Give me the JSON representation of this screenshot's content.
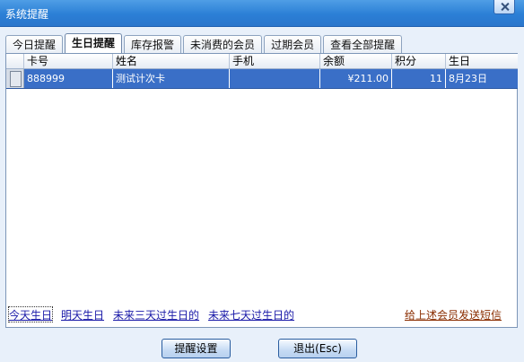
{
  "window": {
    "title": "系统提醒"
  },
  "tabs": [
    {
      "label": "今日提醒",
      "active": false
    },
    {
      "label": "生日提醒",
      "active": true
    },
    {
      "label": "库存报警",
      "active": false
    },
    {
      "label": "未消费的会员",
      "active": false
    },
    {
      "label": "过期会员",
      "active": false
    },
    {
      "label": "查看全部提醒",
      "active": false
    }
  ],
  "grid": {
    "columns": [
      "卡号",
      "姓名",
      "手机",
      "余额",
      "积分",
      "生日"
    ],
    "rows": [
      {
        "card": "888999",
        "name": "测试计次卡",
        "phone": "",
        "balance": "¥211.00",
        "points": "11",
        "birthday": "8月23日",
        "selected": true
      }
    ]
  },
  "filters": {
    "today": "今天生日",
    "tomorrow": "明天生日",
    "next3": "未来三天过生日的",
    "next7": "未来七天过生日的"
  },
  "sms_link": "给上述会员发送短信",
  "buttons": {
    "settings": "提醒设置",
    "exit": "退出(Esc)"
  }
}
